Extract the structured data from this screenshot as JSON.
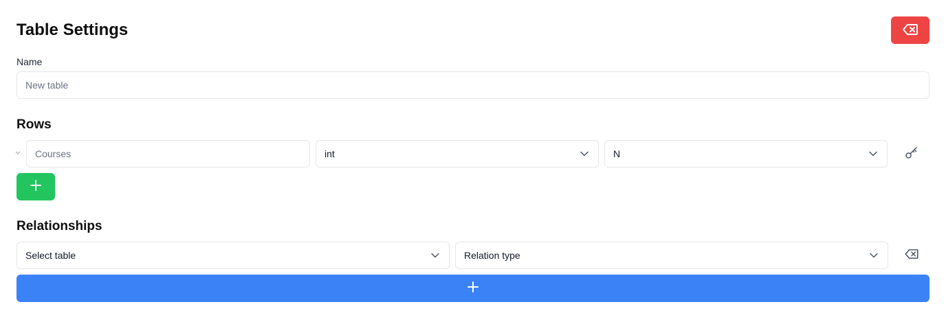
{
  "header": {
    "title": "Table Settings",
    "delete_icon": "delete-backspace-icon"
  },
  "name_field": {
    "label": "Name",
    "placeholder": "New table",
    "value": ""
  },
  "rows_section": {
    "heading": "Rows",
    "rows": [
      {
        "name_placeholder": "Courses",
        "name_value": "",
        "type": "int",
        "nullability": "N",
        "key_icon": "key-icon"
      }
    ],
    "add_icon": "plus-icon"
  },
  "relationships_section": {
    "heading": "Relationships",
    "items": [
      {
        "table": "Select table",
        "relation_type": "Relation type",
        "delete_icon": "delete-backspace-icon"
      }
    ],
    "add_icon": "plus-icon"
  },
  "colors": {
    "danger": "#ef4444",
    "success": "#22c55e",
    "primary": "#3b82f6",
    "border": "#e5e7eb"
  }
}
